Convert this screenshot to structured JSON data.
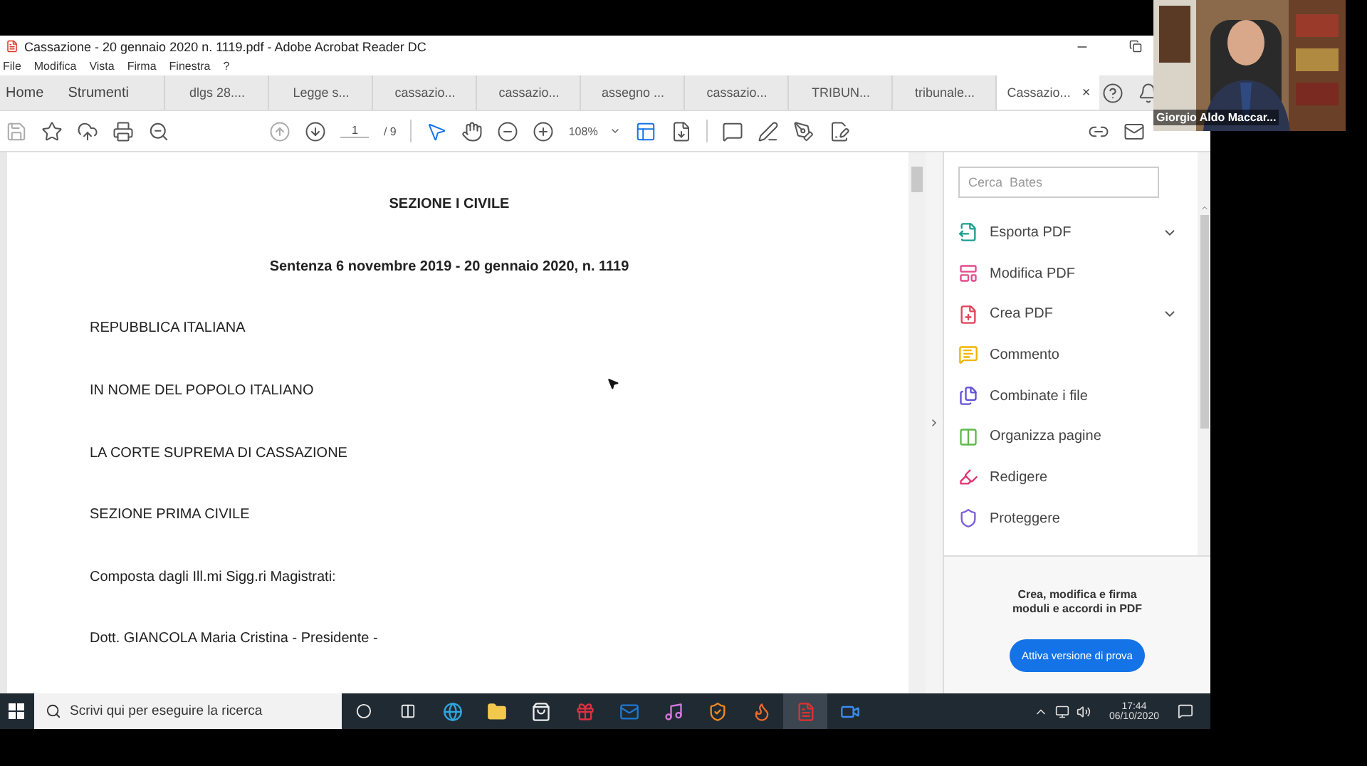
{
  "window": {
    "title": "Cassazione - 20 gennaio 2020 n. 1119.pdf - Adobe Acrobat Reader DC"
  },
  "menu": [
    "File",
    "Modifica",
    "Vista",
    "Firma",
    "Finestra",
    "?"
  ],
  "nav": [
    "Home",
    "Strumenti"
  ],
  "tabs": [
    {
      "label": "dlgs 28....",
      "selected": false
    },
    {
      "label": "Legge s...",
      "selected": false
    },
    {
      "label": "cassazio...",
      "selected": false
    },
    {
      "label": "cassazio...",
      "selected": false
    },
    {
      "label": "assegno ...",
      "selected": false
    },
    {
      "label": "cassazio...",
      "selected": false
    },
    {
      "label": "TRIBUN...",
      "selected": false
    },
    {
      "label": "tribunale...",
      "selected": false
    },
    {
      "label": "Cassazio...",
      "selected": true
    }
  ],
  "tab_close": "×",
  "toolbar": {
    "page": "1",
    "page_total": "/ 9",
    "zoom": "108%"
  },
  "document": [
    {
      "kind": "heading",
      "text": "SEZIONE I CIVILE"
    },
    {
      "kind": "heading",
      "text": "Sentenza 6 novembre 2019 - 20 gennaio 2020, n. 1119"
    },
    {
      "kind": "line",
      "text": "REPUBBLICA ITALIANA"
    },
    {
      "kind": "line",
      "text": "IN NOME DEL POPOLO ITALIANO"
    },
    {
      "kind": "line",
      "text": "LA CORTE SUPREMA DI CASSAZIONE"
    },
    {
      "kind": "line",
      "text": "SEZIONE PRIMA CIVILE"
    },
    {
      "kind": "line",
      "text": "Composta dagli Ill.mi Sigg.ri Magistrati:"
    },
    {
      "kind": "line",
      "text": "Dott. GIANCOLA Maria Cristina - Presidente -"
    }
  ],
  "tools_panel": {
    "search": {
      "placeholder": "Cerca  Bates"
    },
    "items": [
      {
        "label": "Esporta PDF",
        "expandable": true
      },
      {
        "label": "Modifica PDF",
        "expandable": false
      },
      {
        "label": "Crea PDF",
        "expandable": true
      },
      {
        "label": "Commento",
        "expandable": false
      },
      {
        "label": "Combinate i file",
        "expandable": false
      },
      {
        "label": "Organizza pagine",
        "expandable": false
      },
      {
        "label": "Redigere",
        "expandable": false
      },
      {
        "label": "Proteggere",
        "expandable": false
      }
    ],
    "promo": "Crea, modifica e firma moduli e accordi in PDF",
    "trial_button": "Attiva versione di prova"
  },
  "taskbar": {
    "search": {
      "placeholder": "Scrivi qui per eseguire la ricerca"
    },
    "time": "17:44",
    "date": "06/10/2020"
  },
  "video_tile": {
    "name": "Giorgio Aldo Maccar..."
  }
}
